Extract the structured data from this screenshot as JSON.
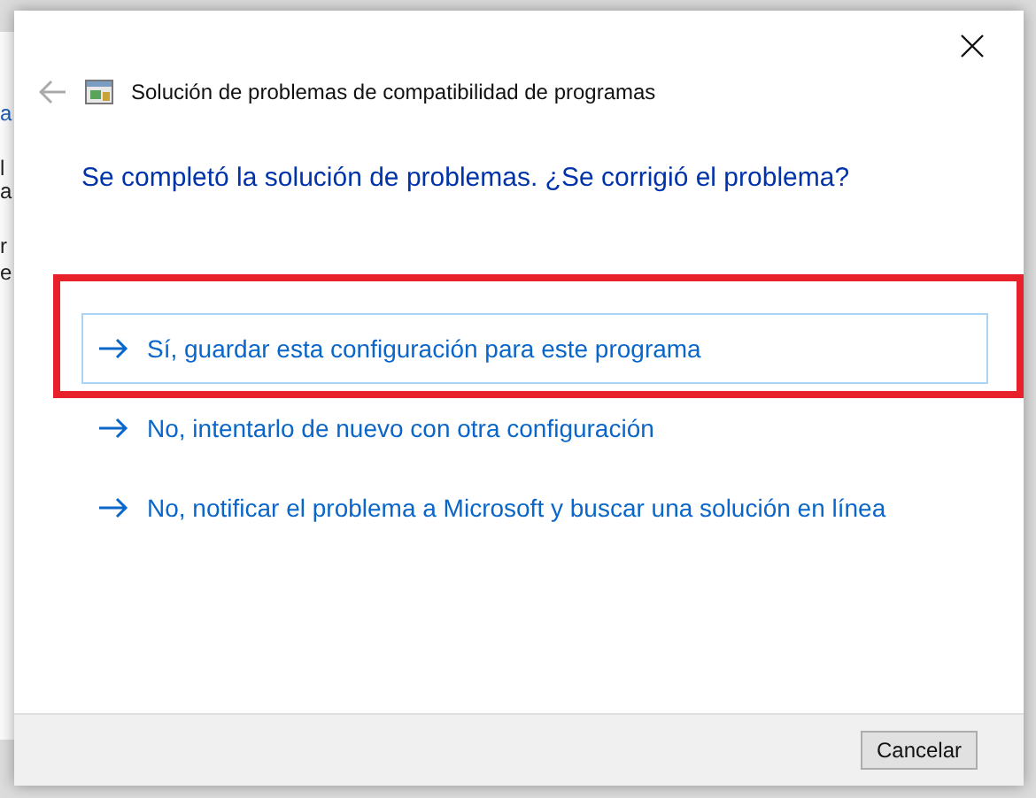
{
  "background_window": {
    "fragments": [
      "a",
      "l",
      "a",
      "r",
      "e"
    ]
  },
  "dialog": {
    "title": "Solución de problemas de compatibilidad de programas",
    "heading": "Se completó la solución de problemas. ¿Se corrigió el problema?",
    "options": [
      {
        "label": "Sí, guardar esta configuración para este programa",
        "selected": true,
        "highlighted": true
      },
      {
        "label": "No, intentarlo de nuevo con otra configuración",
        "selected": false,
        "highlighted": false
      },
      {
        "label": "No, notificar el problema a Microsoft y buscar una solución en línea",
        "selected": false,
        "highlighted": false
      }
    ],
    "buttons": [
      "Cancelar"
    ]
  }
}
